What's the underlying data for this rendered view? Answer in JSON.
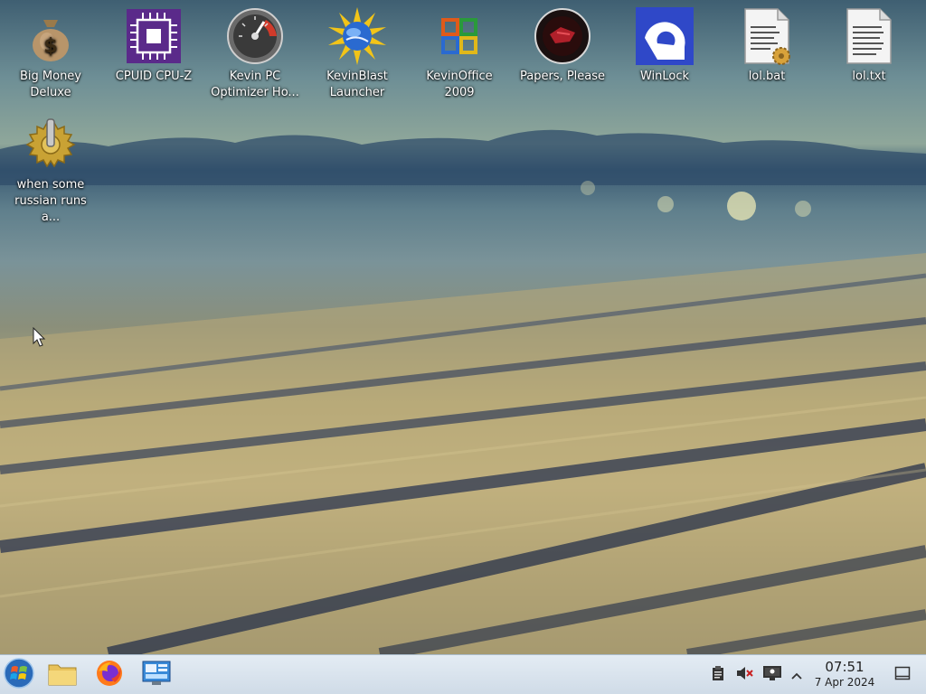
{
  "desktop": {
    "icons": [
      {
        "label": "Big Money Deluxe",
        "icon": "money-bag-icon"
      },
      {
        "label": "CPUID CPU-Z",
        "icon": "cpu-chip-icon"
      },
      {
        "label": "Kevin PC Optimizer Ho...",
        "icon": "speedometer-icon"
      },
      {
        "label": "KevinBlast Launcher",
        "icon": "sun-globe-icon"
      },
      {
        "label": "KevinOffice 2009",
        "icon": "office-logo-icon"
      },
      {
        "label": "Papers, Please",
        "icon": "papers-please-seal-icon"
      },
      {
        "label": "WinLock",
        "icon": "winlock-icon"
      },
      {
        "label": "lol.bat",
        "icon": "batch-file-icon"
      },
      {
        "label": "lol.txt",
        "icon": "text-file-icon"
      },
      {
        "label": "when some russian runs a...",
        "icon": "gear-joystick-icon"
      }
    ]
  },
  "taskbar": {
    "items": [
      {
        "name": "start-button",
        "icon": "windows-orb-icon"
      },
      {
        "name": "file-explorer",
        "icon": "folder-icon"
      },
      {
        "name": "firefox",
        "icon": "firefox-icon"
      },
      {
        "name": "system-tool",
        "icon": "monitor-window-icon"
      }
    ],
    "tray": {
      "clipboard_icon": "clipboard-icon",
      "volume_icon": "volume-muted-icon",
      "network_icon": "network-monitor-icon",
      "expand_icon": "chevron-up-icon",
      "show_desktop_icon": "show-desktop-icon"
    },
    "clock": {
      "time": "07:51",
      "date": "7 Apr 2024"
    }
  }
}
